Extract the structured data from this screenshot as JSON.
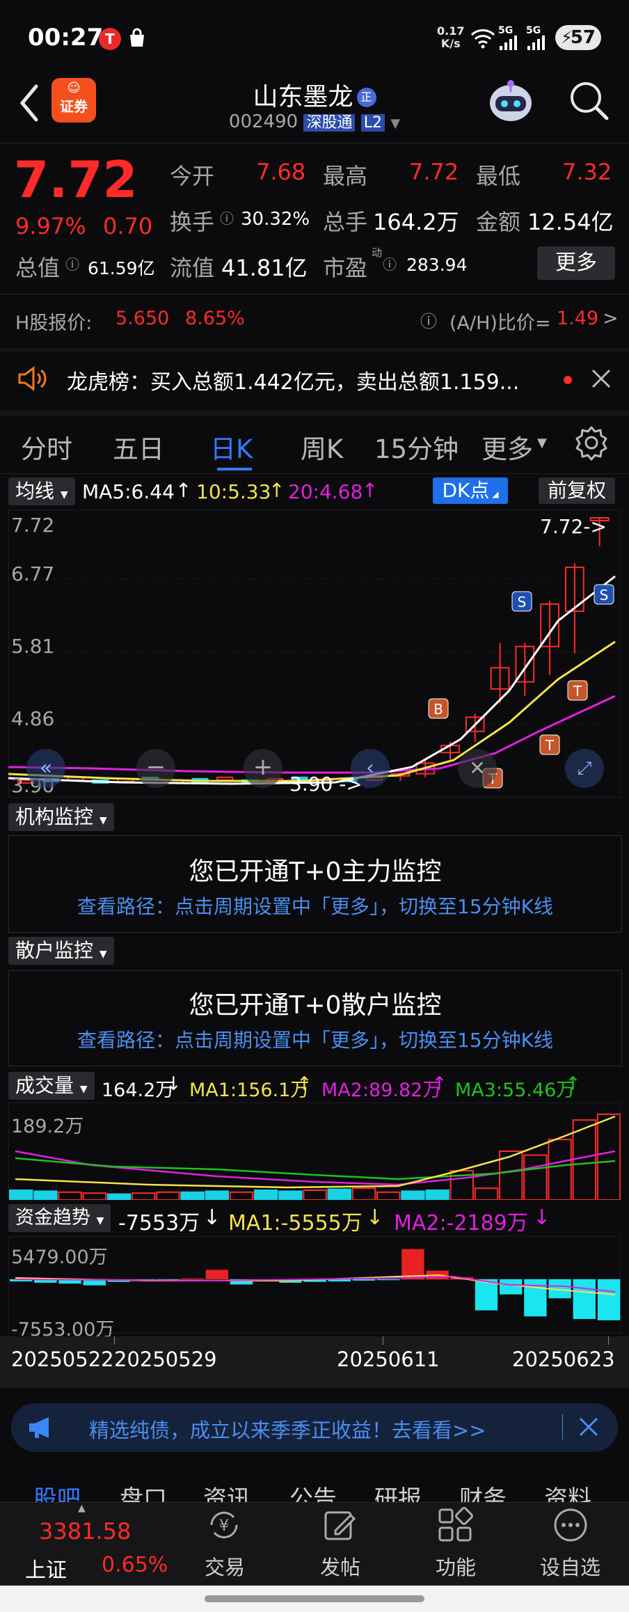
{
  "status_bar": {
    "time": "00:27",
    "speed_value": "0.17",
    "speed_unit": "K/s",
    "net1": "5G",
    "net2": "5G",
    "battery": "57"
  },
  "header": {
    "app_badge": "证券",
    "stock_name": "山东墨龙",
    "zheng_badge": "正",
    "stock_code": "002490",
    "connect_tag": "深股通",
    "level_tag": "L2"
  },
  "quote": {
    "price": "7.72",
    "change_pct": "9.97%",
    "change_amt": "0.70",
    "open_label": "今开",
    "open_value": "7.68",
    "high_label": "最高",
    "high_value": "7.72",
    "low_label": "最低",
    "low_value": "7.32",
    "turnover_label": "换手",
    "turnover_value": "30.32%",
    "volume_label": "总手",
    "volume_value": "164.2万",
    "amount_label": "金额",
    "amount_value": "12.54亿",
    "mktcap_label": "总值",
    "mktcap_value": "61.59亿",
    "float_label": "流值",
    "float_value": "41.81亿",
    "pe_label": "市盈",
    "pe_sup": "动",
    "pe_value": "283.94",
    "more_button": "更多"
  },
  "hshare": {
    "label": "H股报价:",
    "price": "5.650",
    "pct": "8.65%",
    "ratio_label": "(A/H)比价=",
    "ratio_value": "1.49"
  },
  "notice": {
    "text": "龙虎榜：买入总额1.442亿元，卖出总额1.159..."
  },
  "tabs": [
    "分时",
    "五日",
    "日K",
    "周K",
    "15分钟",
    "更多"
  ],
  "kline": {
    "ma_select": "均线",
    "ma5": "MA5:6.44",
    "ma10": "10:5.33",
    "ma20": "20:4.68",
    "dk_button": "DK点",
    "adjust_button": "前复权",
    "price_labels": [
      "7.72",
      "6.77",
      "5.81",
      "4.86",
      "3.90"
    ],
    "last_price_tag": "7.72->",
    "low_price_tag": "3.90 ->"
  },
  "chart_data": {
    "type": "candlestick",
    "ylim": [
      3.9,
      7.72
    ],
    "ohlc_recent": [
      {
        "o": 4.07,
        "h": 4.12,
        "l": 4.0,
        "c": 4.1
      },
      {
        "o": 4.1,
        "h": 4.3,
        "l": 4.05,
        "c": 4.25
      },
      {
        "o": 4.4,
        "h": 4.55,
        "l": 4.3,
        "c": 4.5
      },
      {
        "o": 4.7,
        "h": 4.95,
        "l": 4.55,
        "c": 4.9
      },
      {
        "o": 5.3,
        "h": 5.95,
        "l": 5.1,
        "c": 5.6
      },
      {
        "o": 5.4,
        "h": 5.95,
        "l": 5.2,
        "c": 5.9
      },
      {
        "o": 5.9,
        "h": 6.55,
        "l": 5.5,
        "c": 6.5
      },
      {
        "o": 6.4,
        "h": 7.08,
        "l": 5.8,
        "c": 7.02
      },
      {
        "o": 7.68,
        "h": 7.72,
        "l": 7.32,
        "c": 7.72
      }
    ],
    "markers": [
      "B",
      "T",
      "T",
      "T",
      "S",
      "S"
    ],
    "series": [
      {
        "name": "MA5",
        "color": "#ffffff"
      },
      {
        "name": "10",
        "color": "#f4e34a"
      },
      {
        "name": "20",
        "color": "#e020e0"
      }
    ],
    "dates": [
      "20250522",
      "20250529",
      "20250611",
      "20250623"
    ]
  },
  "inst_monitor": {
    "title": "机构监控",
    "heading": "您已开通T+0主力监控",
    "path": "查看路径：点击周期设置中「更多」，切换至15分钟K线"
  },
  "retail_monitor": {
    "title": "散户监控",
    "heading": "您已开通T+0散户监控",
    "path": "查看路径：点击周期设置中「更多」，切换至15分钟K线"
  },
  "volume": {
    "title": "成交量",
    "value": "164.2万",
    "ma1": "MA1:156.1万",
    "ma2": "MA2:89.82万",
    "ma3": "MA3:55.46万",
    "max_label": "189.2万",
    "bars": [
      0.1,
      0.09,
      0.08,
      0.07,
      0.06,
      0.07,
      0.08,
      0.08,
      0.09,
      0.08,
      0.1,
      0.09,
      0.1,
      0.11,
      0.12,
      0.08,
      0.09,
      0.1,
      0.3,
      0.12,
      0.5,
      0.46,
      0.62,
      0.82,
      0.88
    ],
    "colors": [
      "c",
      "c",
      "r",
      "r",
      "c",
      "r",
      "r",
      "c",
      "c",
      "r",
      "c",
      "c",
      "r",
      "c",
      "r",
      "r",
      "c",
      "c",
      "r",
      "r",
      "r",
      "r",
      "r",
      "r",
      "r"
    ]
  },
  "fund_flow": {
    "title": "资金趋势",
    "value": "-7553万",
    "ma1": "MA1:-5555万",
    "ma2": "MA2:-2189万",
    "top_label": "5479.00万",
    "bottom_label": "-7553.00万",
    "bars": [
      -0.05,
      -0.08,
      -0.1,
      -0.14,
      -0.06,
      -0.03,
      -0.04,
      0.02,
      0.22,
      -0.12,
      -0.05,
      -0.08,
      -0.06,
      -0.05,
      -0.03,
      -0.02,
      0.7,
      0.2,
      0.05,
      -0.72,
      -0.35,
      -0.86,
      -0.44,
      -0.92,
      -0.95
    ]
  },
  "dates": [
    "20250522",
    "20250529",
    "20250611",
    "20250623"
  ],
  "ad": {
    "text": "精选纯债，成立以来季季正收益！去看看>>"
  },
  "bottom_tabs": [
    "股吧",
    "盘口",
    "资讯",
    "公告",
    "研报",
    "财务",
    "资料"
  ],
  "nav": {
    "index_value": "3381.58",
    "index_name": "上证",
    "index_pct": "0.65%",
    "trade": "交易",
    "post": "发帖",
    "func": "功能",
    "custom": "设自选"
  }
}
